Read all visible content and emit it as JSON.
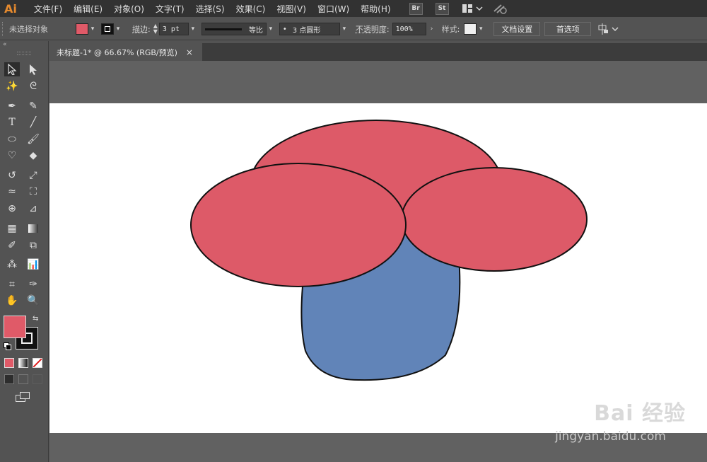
{
  "app": {
    "logo": "Ai"
  },
  "menu": [
    "文件(F)",
    "编辑(E)",
    "对象(O)",
    "文字(T)",
    "选择(S)",
    "效果(C)",
    "视图(V)",
    "窗口(W)",
    "帮助(H)"
  ],
  "menu_ext": {
    "bridge": "Br",
    "stock": "St"
  },
  "control": {
    "selection": "未选择对象",
    "fill_color": "#e05a68",
    "stroke_label": "描边",
    "stroke_weight": "3 pt",
    "profile_label": "等比",
    "brush_label": "3 点圆形",
    "opacity_label": "不透明度",
    "opacity_value": "100%",
    "style_label": "样式",
    "doc_setup": "文档设置",
    "preferences": "首选项"
  },
  "tab": {
    "title": "未标题-1* @ 66.67% (RGB/预览)",
    "close": "×"
  },
  "shapes": {
    "cap_color": "#dd5a68",
    "stem_color": "#6184b8",
    "outline_color": "#111111"
  },
  "watermark": {
    "brand": "Bai 经验",
    "url": "jingyan.baidu.com"
  }
}
